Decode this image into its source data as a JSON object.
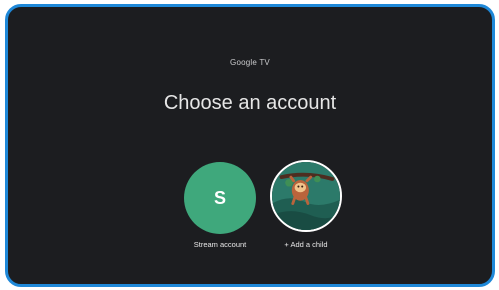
{
  "app": {
    "brand": "Google TV",
    "title": "Choose an account"
  },
  "accounts": [
    {
      "initial": "S",
      "label": "Stream account",
      "color": "#3fa87c"
    },
    {
      "label": "+ Add a child",
      "icon": "sloth-illustration"
    }
  ],
  "colors": {
    "background": "#1c1d20",
    "frame_border": "#1e88d8",
    "accent_green": "#3fa87c"
  }
}
